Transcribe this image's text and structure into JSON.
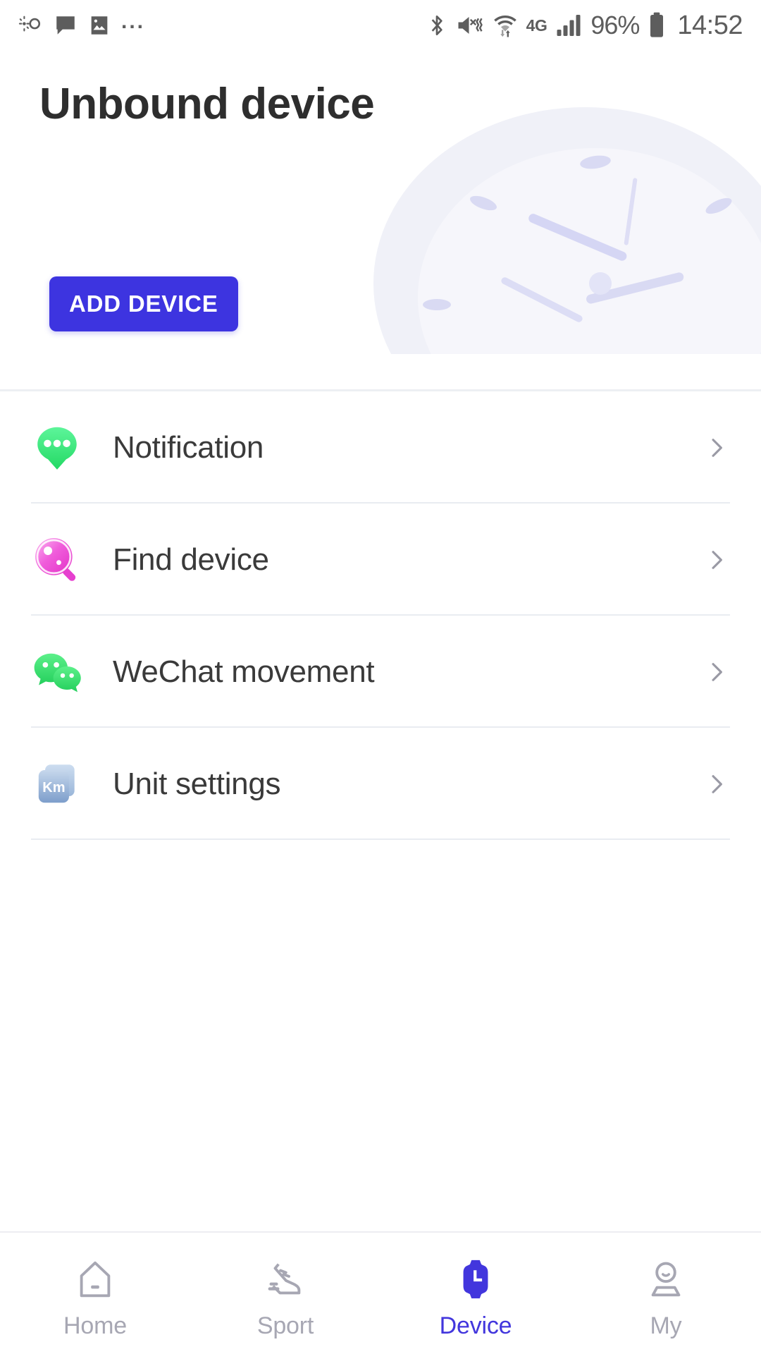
{
  "status_bar": {
    "left_icons": [
      "weather-icon",
      "message-icon",
      "photo-icon",
      "more-dots-icon"
    ],
    "more_dots": "...",
    "right_icons": [
      "bluetooth-icon",
      "mute-vibrate-icon",
      "wifi-icon",
      "signal-bars-icon",
      "battery-icon"
    ],
    "network": "4G",
    "battery_percent": "96%",
    "time": "14:52"
  },
  "header": {
    "title": "Unbound device",
    "add_device_label": "ADD DEVICE",
    "accent_color": "#3d34e0",
    "artwork": "watch-face-illustration"
  },
  "menu": {
    "items": [
      {
        "label": "Notification",
        "icon": "notification-bubble-icon",
        "icon_color": "#41e07a"
      },
      {
        "label": "Find device",
        "icon": "magnifier-icon",
        "icon_color": "#ef4ad2"
      },
      {
        "label": "WeChat movement",
        "icon": "wechat-icon",
        "icon_color": "#3ddd6f"
      },
      {
        "label": "Unit settings",
        "icon": "km-cards-icon",
        "icon_color": "#8fa9cf",
        "icon_text": "Km"
      }
    ],
    "chevron_icon": "chevron-right-icon"
  },
  "bottom_nav": {
    "active_index": 2,
    "active_color": "#4236dd",
    "inactive_color": "#a7a7b3",
    "items": [
      {
        "label": "Home",
        "icon": "home-icon"
      },
      {
        "label": "Sport",
        "icon": "shoe-icon"
      },
      {
        "label": "Device",
        "icon": "watch-icon"
      },
      {
        "label": "My",
        "icon": "person-icon"
      }
    ]
  }
}
